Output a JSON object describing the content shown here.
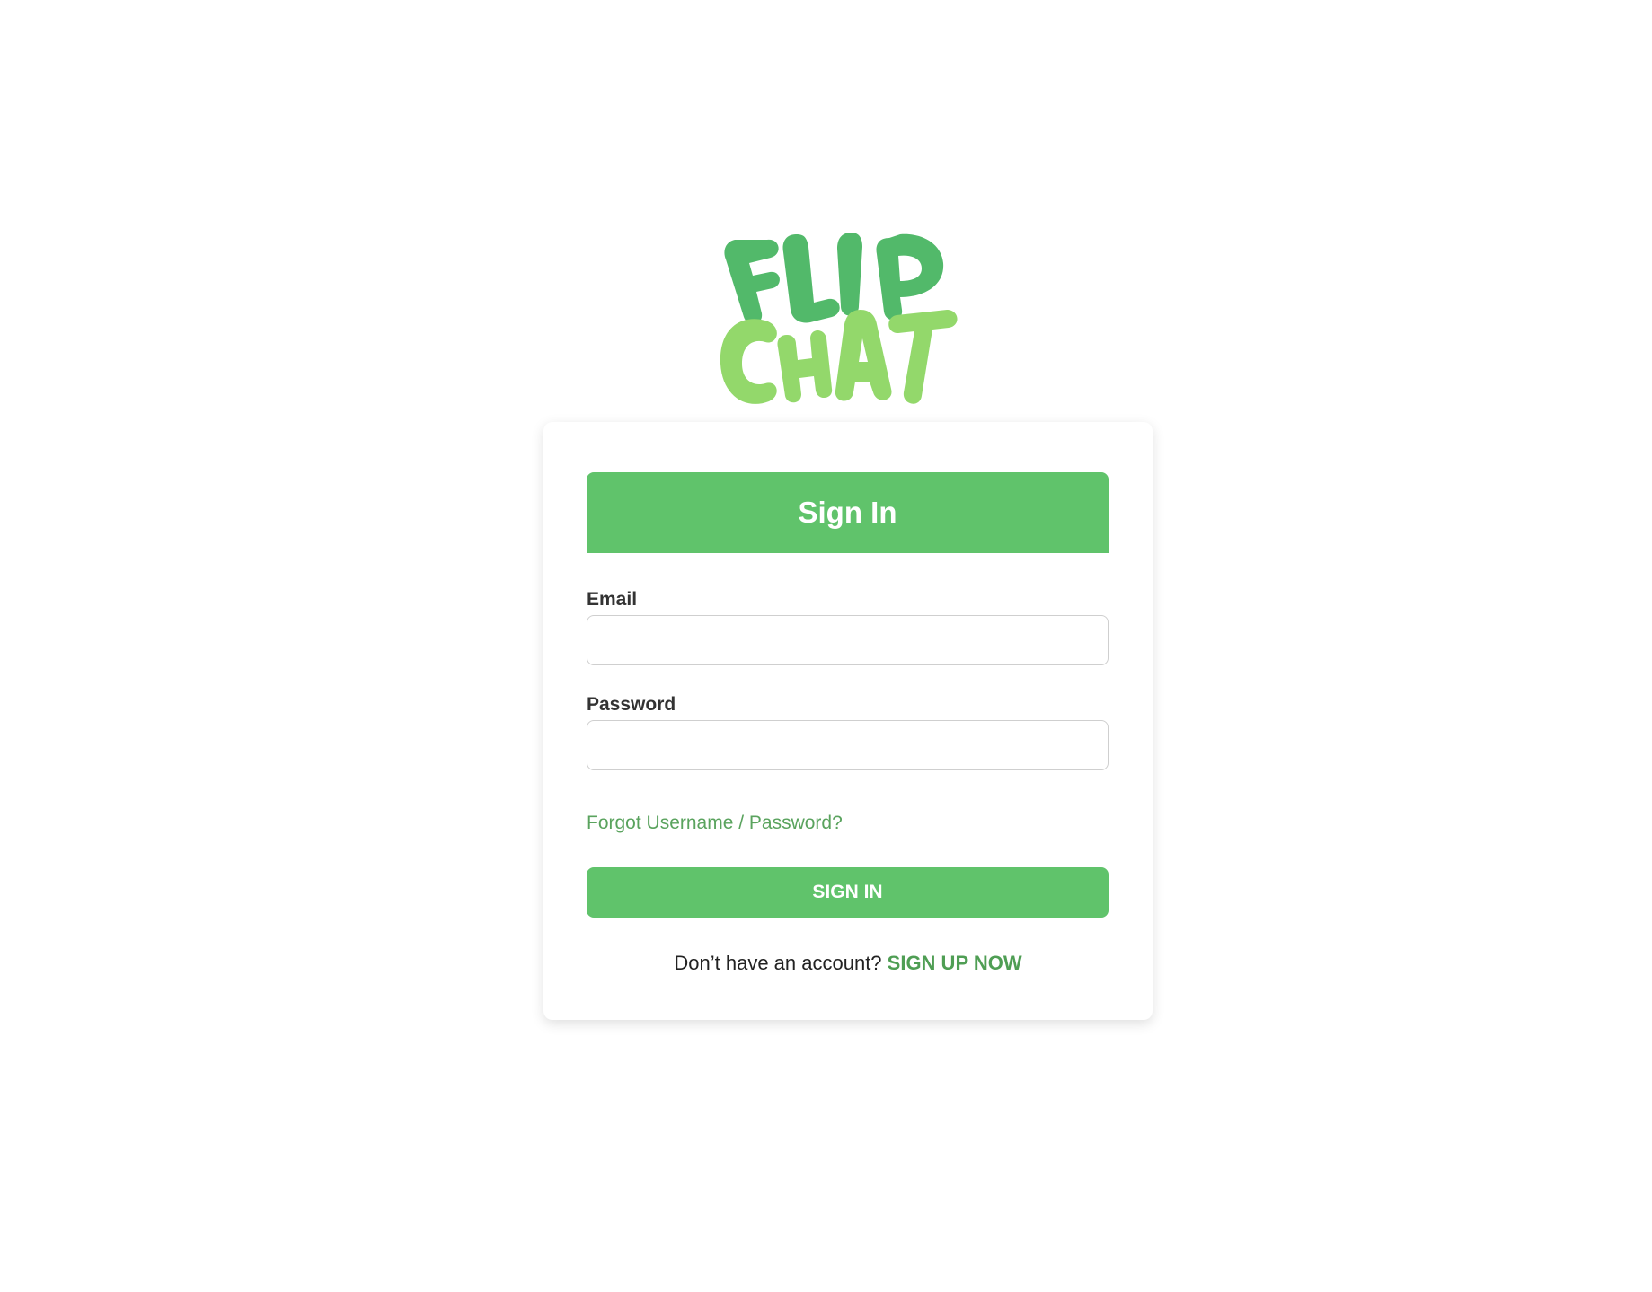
{
  "logo": {
    "line1": "FLIP",
    "line2": "CHAT",
    "colors": {
      "top": "#52b96a",
      "bottom": "#93d86b"
    }
  },
  "card": {
    "title": "Sign In",
    "email": {
      "label": "Email",
      "value": "",
      "placeholder": ""
    },
    "password": {
      "label": "Password",
      "value": "",
      "placeholder": ""
    },
    "forgot_link": "Forgot Username / Password?",
    "submit_label": "SIGN IN",
    "signup": {
      "prompt": "Don’t have an account?",
      "link": "SIGN UP NOW"
    }
  },
  "colors": {
    "accent": "#60c36b",
    "link": "#5aa35e",
    "text": "#333333",
    "background": "#ffffff"
  }
}
